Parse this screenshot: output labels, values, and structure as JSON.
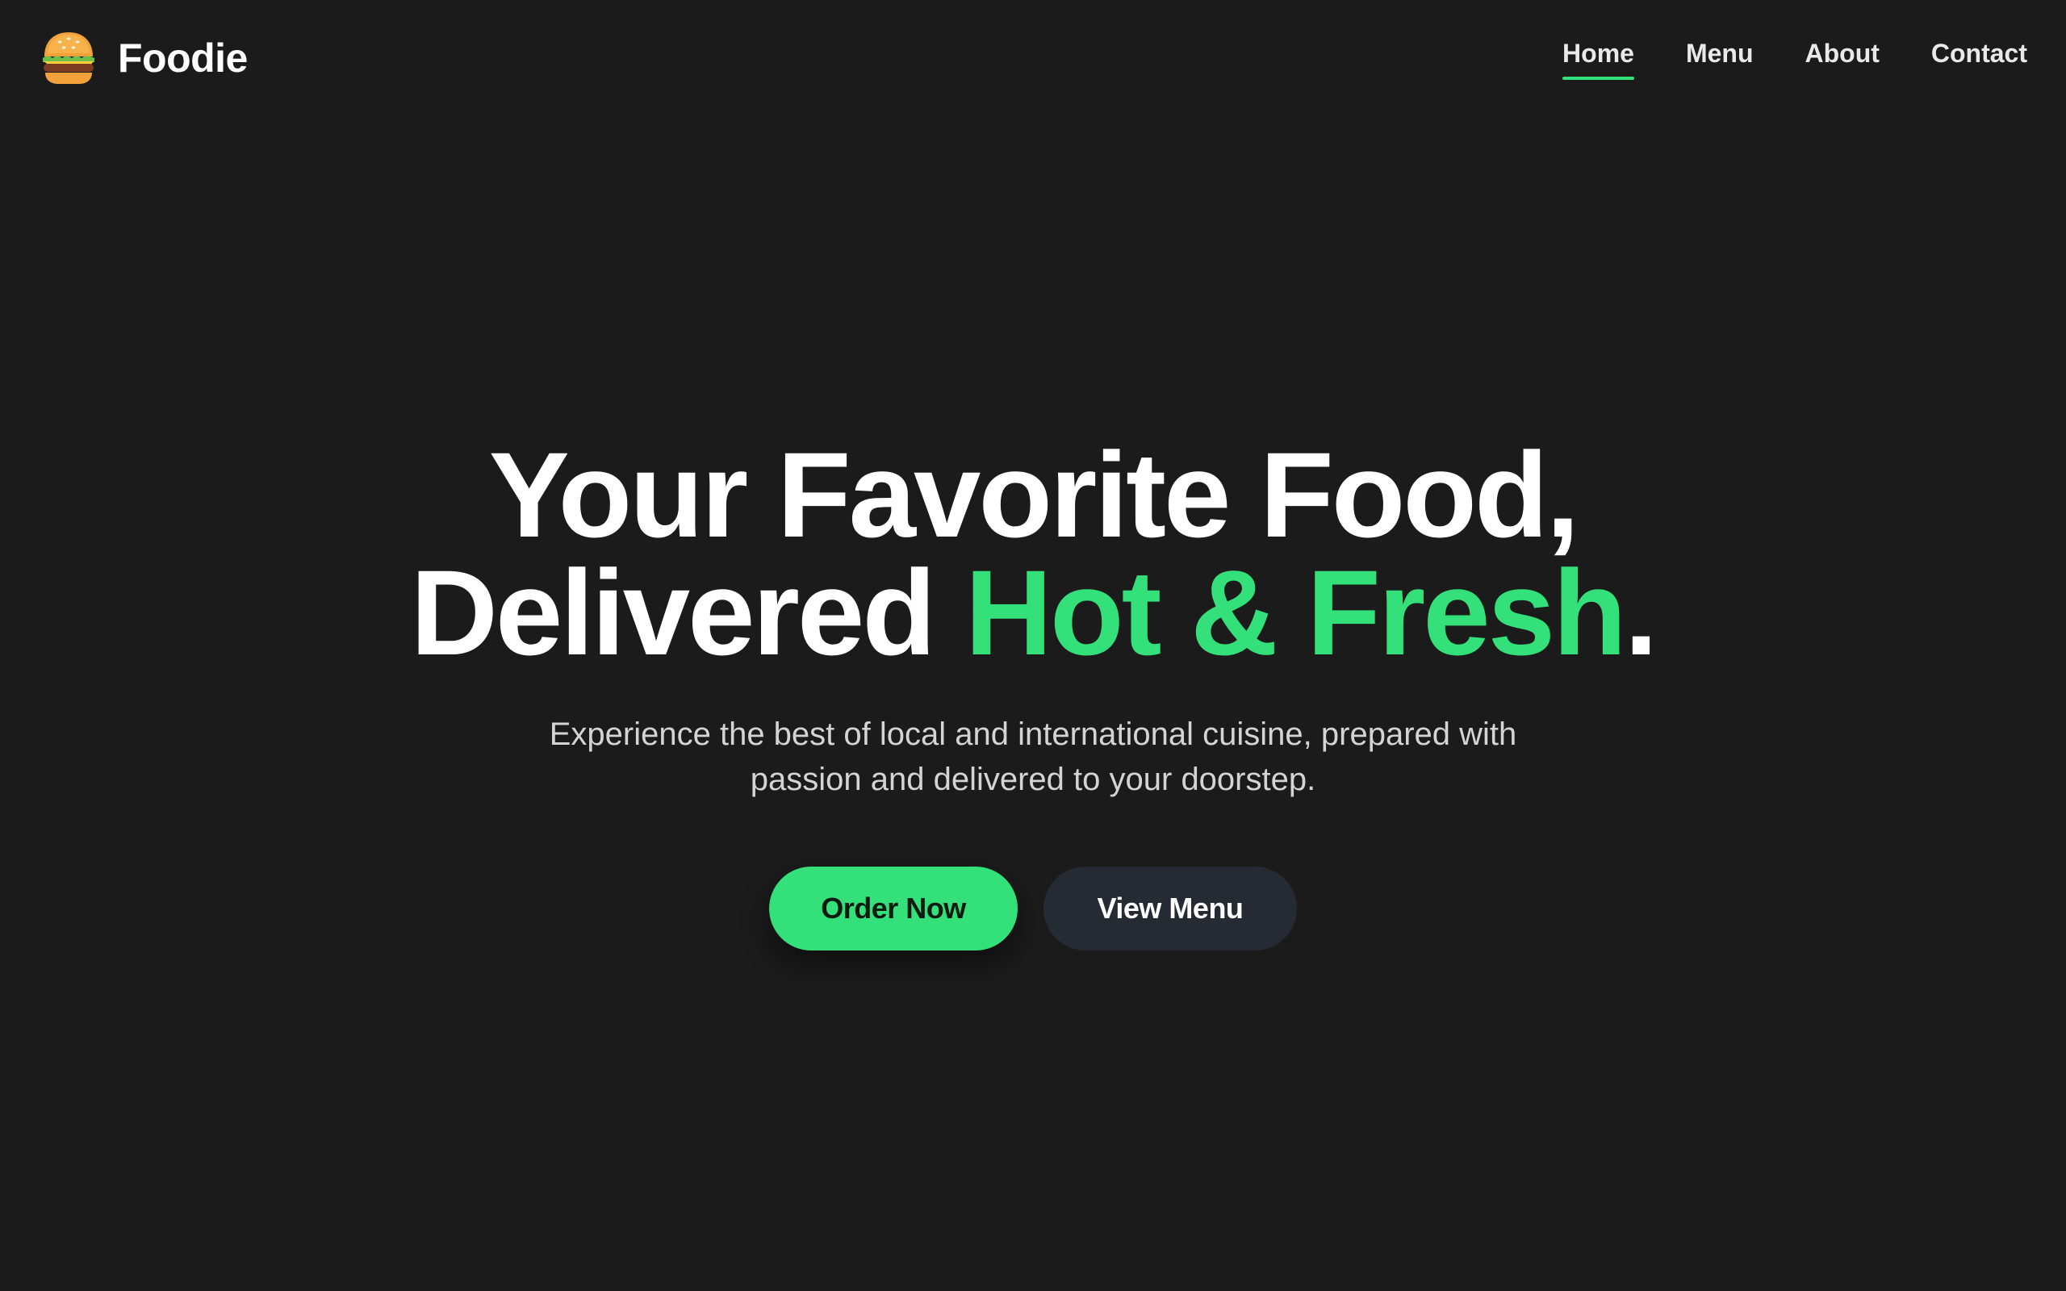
{
  "brand": {
    "name": "Foodie",
    "logo_icon": "burger-icon"
  },
  "nav": {
    "items": [
      {
        "label": "Home",
        "active": true
      },
      {
        "label": "Menu",
        "active": false
      },
      {
        "label": "About",
        "active": false
      },
      {
        "label": "Contact",
        "active": false
      }
    ]
  },
  "hero": {
    "headline_line1": "Your Favorite Food,",
    "headline_line2_prefix": "Delivered ",
    "headline_line2_accent": "Hot & Fresh",
    "headline_line2_suffix": ".",
    "subtitle_line1": "Experience the best of local and international cuisine, prepared with",
    "subtitle_line2": "passion and delivered to your doorstep.",
    "primary_button": "Order Now",
    "secondary_button": "View Menu"
  },
  "colors": {
    "background": "#1b1b1b",
    "accent": "#33e07a",
    "secondary_button": "#262a33",
    "text": "#ffffff",
    "muted_text": "#d4d4d4"
  }
}
